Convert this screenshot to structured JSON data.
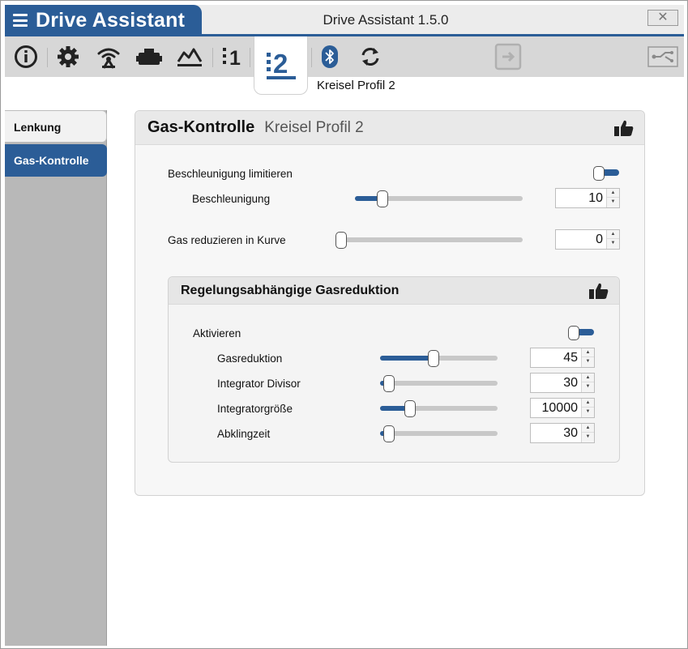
{
  "app": {
    "brand_title": "Drive Assistant",
    "window_title": "Drive Assistant 1.5.0",
    "close_label": "✕"
  },
  "toolbar": {
    "items": [
      {
        "icon": "info-icon"
      },
      {
        "icon": "gear-icon"
      },
      {
        "icon": "antenna-icon"
      },
      {
        "icon": "motor-icon"
      },
      {
        "icon": "chart-icon"
      },
      {
        "icon": "profile-1-icon",
        "label": "1"
      },
      {
        "icon": "profile-2-icon",
        "label": "2",
        "active": true
      },
      {
        "icon": "bluetooth-icon"
      },
      {
        "icon": "sync-icon"
      },
      {
        "icon": "import-icon"
      },
      {
        "icon": "connection-icon"
      }
    ],
    "active_label": "Kreisel Profil 2"
  },
  "sidebar": {
    "items": [
      {
        "label": "Lenkung",
        "active": false
      },
      {
        "label": "Gas-Kontrolle",
        "active": true
      }
    ]
  },
  "card": {
    "title": "Gas-Kontrolle",
    "subtitle": "Kreisel Profil 2",
    "accel_limit_label": "Beschleunigung limitieren",
    "accel_limit_on": true,
    "accel_label": "Beschleunigung",
    "accel_value": "10",
    "accel_slider_fraction": 0.14,
    "curve_label": "Gas reduzieren in Kurve",
    "curve_value": "0",
    "curve_slider_fraction": 0.0
  },
  "group": {
    "title": "Regelungsabhängige Gasreduktion",
    "activate_label": "Aktivieren",
    "activate_on": true,
    "rows": [
      {
        "label": "Gasreduktion",
        "value": "45",
        "fraction": 0.45
      },
      {
        "label": "Integrator Divisor",
        "value": "30",
        "fraction": 0.03
      },
      {
        "label": "Integratorgröße",
        "value": "10000",
        "fraction": 0.23
      },
      {
        "label": "Abklingzeit",
        "value": "30",
        "fraction": 0.03
      }
    ]
  },
  "colors": {
    "accent": "#2b5d97",
    "toolbar": "#d7d7d7",
    "sidebar": "#b8b8b8"
  }
}
